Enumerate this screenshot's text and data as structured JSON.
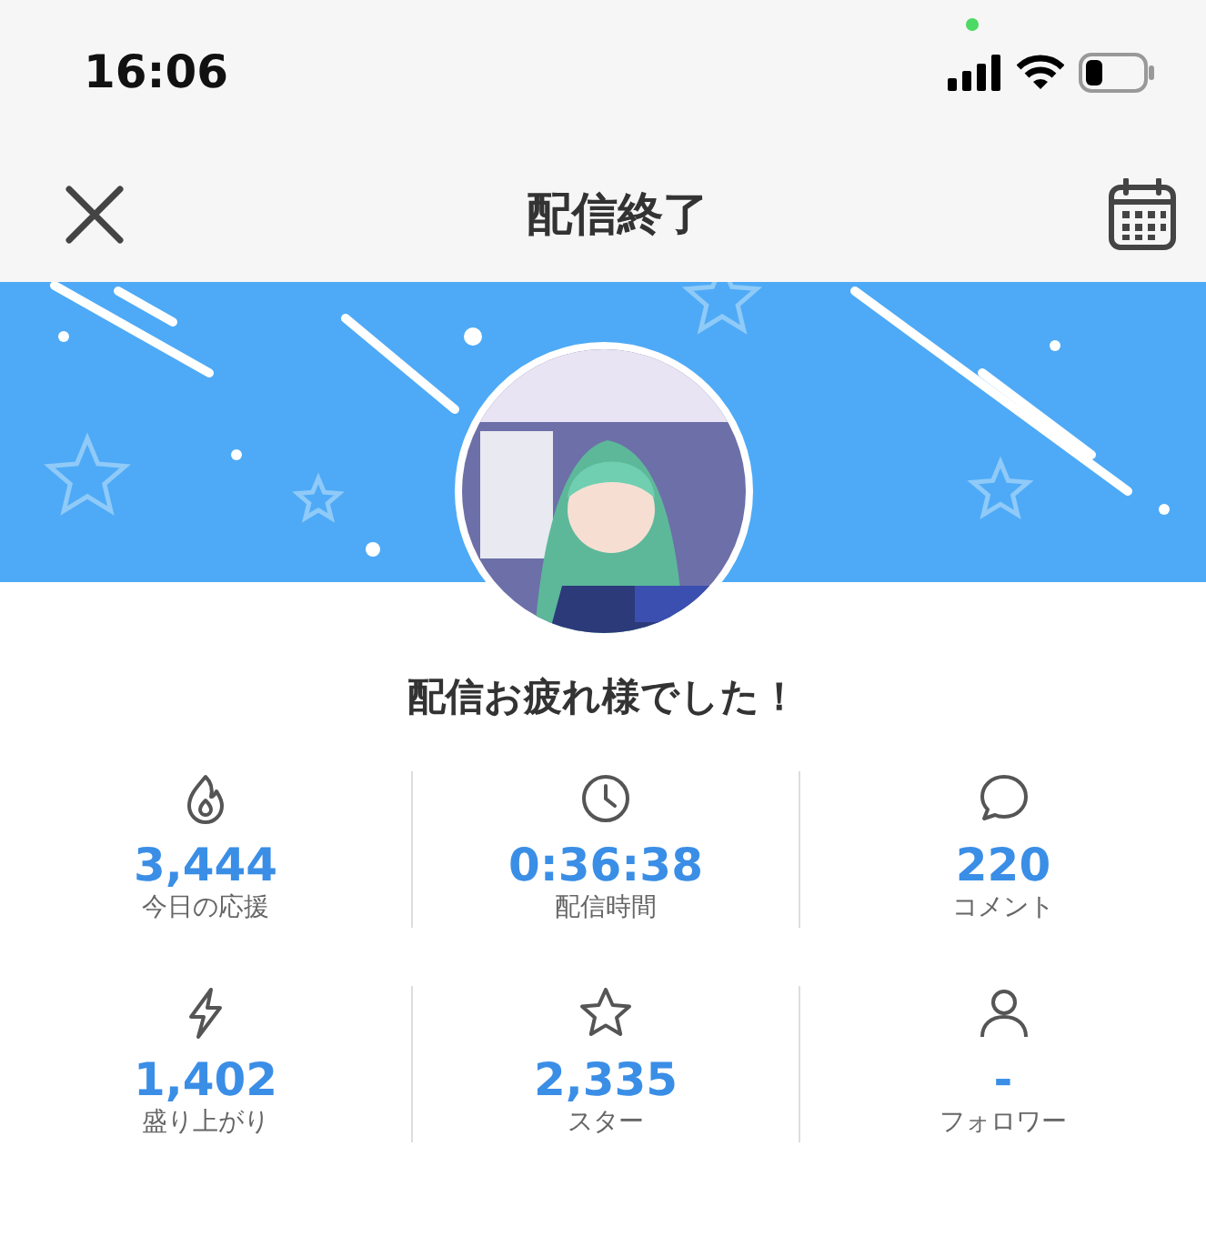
{
  "status_bar": {
    "time": "16:06"
  },
  "header": {
    "title": "配信終了"
  },
  "message": "配信お疲れ様でした！",
  "stats": [
    {
      "kind": "flame",
      "value": "3,444",
      "label": "今日の応援"
    },
    {
      "kind": "clock",
      "value": "0:36:38",
      "label": "配信時間"
    },
    {
      "kind": "comment",
      "value": "220",
      "label": "コメント"
    },
    {
      "kind": "bolt",
      "value": "1,402",
      "label": "盛り上がり"
    },
    {
      "kind": "star",
      "value": "2,335",
      "label": "スター"
    },
    {
      "kind": "person",
      "value": "-",
      "label": "フォロワー"
    }
  ]
}
